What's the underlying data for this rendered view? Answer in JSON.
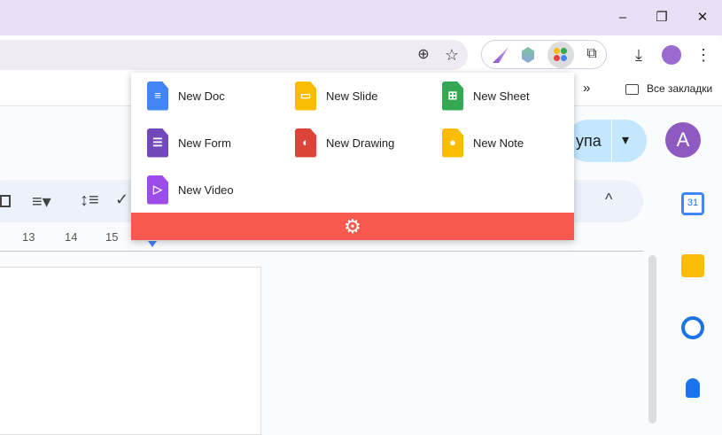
{
  "window": {
    "minimize": "–",
    "restore": "❐",
    "close": "✕"
  },
  "toolbar": {
    "zoom_icon": "⊕",
    "star_icon": "☆",
    "download_icon": "⤓",
    "menu_icon": "⋮",
    "extensions_icon": "⧉"
  },
  "bookmarks": {
    "overflow": "»",
    "all_bookmarks": "Все закладки"
  },
  "docs": {
    "share_label": "упа",
    "share_dropdown": "▾",
    "avatar_letter": "A",
    "collapse": "^",
    "ruler": [
      "13",
      "14",
      "15"
    ]
  },
  "popup": {
    "items": [
      {
        "label": "New Doc",
        "color": "#4285f4",
        "glyph": "≡"
      },
      {
        "label": "New Slide",
        "color": "#fbbc04",
        "glyph": "▭"
      },
      {
        "label": "New Sheet",
        "color": "#34a853",
        "glyph": "⊞"
      },
      {
        "label": "New Form",
        "color": "#7248b9",
        "glyph": "☰"
      },
      {
        "label": "New Drawing",
        "color": "#db4437",
        "glyph": "◐"
      },
      {
        "label": "New Note",
        "color": "#fbbc04",
        "glyph": "●"
      },
      {
        "label": "New Video",
        "color": "#9c4ce8",
        "glyph": "▷"
      }
    ],
    "settings_icon": "⚙",
    "footer_color": "#f65a4e"
  },
  "sidepanel": {
    "calendar_label": "31"
  }
}
